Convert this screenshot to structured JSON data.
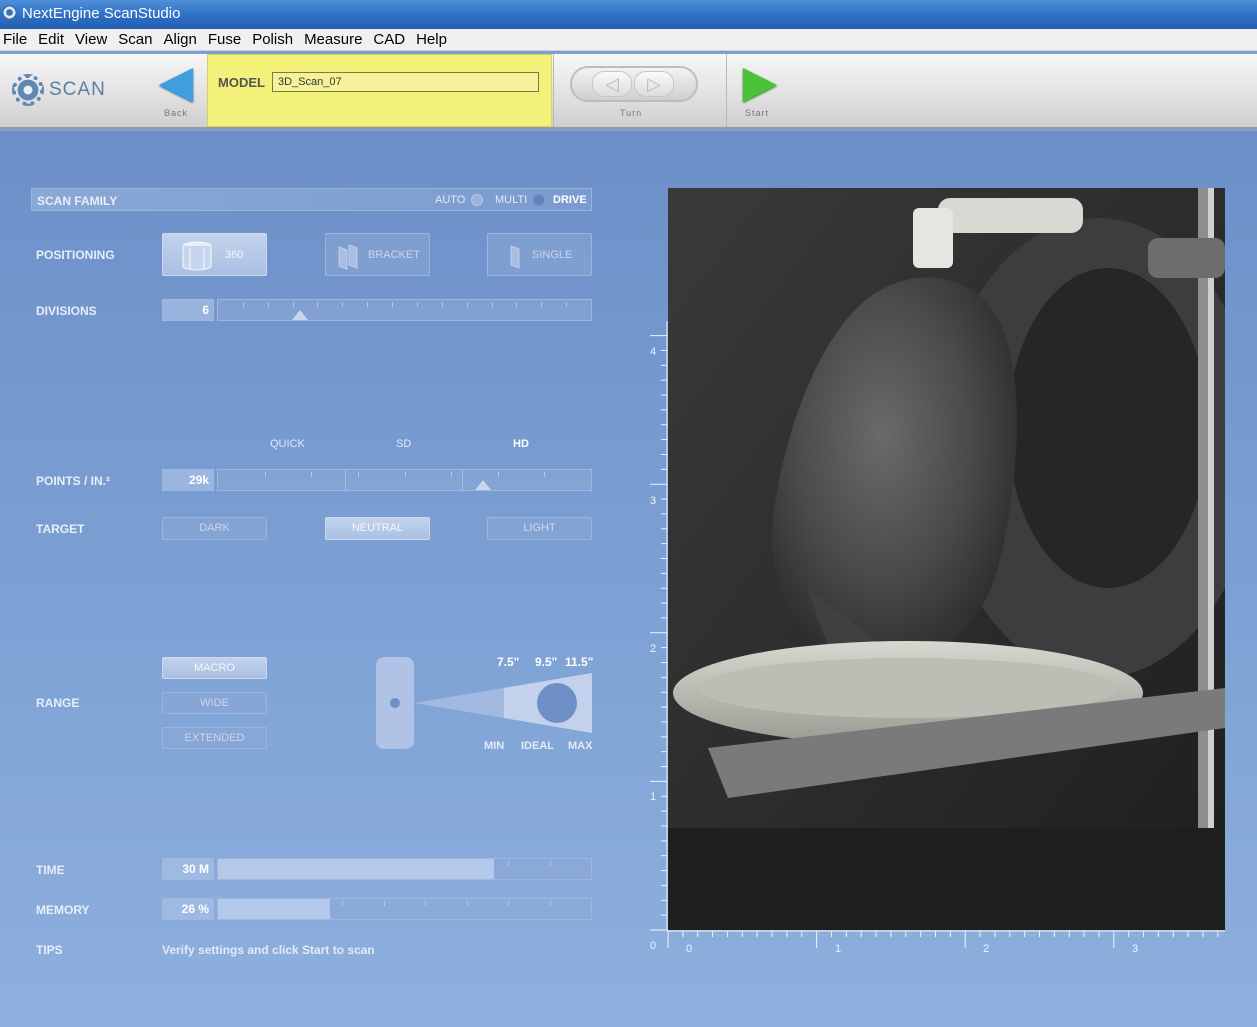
{
  "window": {
    "title": "NextEngine ScanStudio"
  },
  "menu": [
    "File",
    "Edit",
    "View",
    "Scan",
    "Align",
    "Fuse",
    "Polish",
    "Measure",
    "CAD",
    "Help"
  ],
  "toolbar": {
    "section_label": "SCAN",
    "back_label": "Back",
    "model_label": "MODEL",
    "model_value": "3D_Scan_07",
    "turn_label": "Turn",
    "start_label": "Start"
  },
  "scan_family": {
    "label": "SCAN FAMILY",
    "options": [
      {
        "label": "AUTO",
        "selected": false
      },
      {
        "label": "MULTI",
        "selected": true
      },
      {
        "label": "DRIVE",
        "selected": false
      }
    ]
  },
  "positioning": {
    "label": "POSITIONING",
    "options": [
      "360",
      "BRACKET",
      "SINGLE"
    ],
    "selected": "360"
  },
  "divisions": {
    "label": "DIVISIONS",
    "value": "6",
    "level": 0.22
  },
  "points": {
    "label": "POINTS / IN.²",
    "value": "29k",
    "presets": [
      "QUICK",
      "SD",
      "HD"
    ],
    "level": 0.71
  },
  "target": {
    "label": "TARGET",
    "options": [
      "DARK",
      "NEUTRAL",
      "LIGHT"
    ],
    "selected": "NEUTRAL"
  },
  "range": {
    "label": "RANGE",
    "options": [
      "MACRO",
      "WIDE",
      "EXTENDED"
    ],
    "selected": "MACRO",
    "distances": [
      "7.5\"",
      "9.5\"",
      "11.5\""
    ],
    "distance_labels": [
      "MIN",
      "IDEAL",
      "MAX"
    ]
  },
  "time": {
    "label": "TIME",
    "value": "30 M",
    "level": 0.74
  },
  "memory": {
    "label": "MEMORY",
    "value": "26 %",
    "level": 0.3
  },
  "tips": {
    "label": "TIPS",
    "text": "Verify settings and click Start to scan"
  },
  "ruler": {
    "vertical": [
      "4",
      "3",
      "2",
      "1",
      "0"
    ],
    "horizontal": [
      "0",
      "1",
      "2",
      "3"
    ]
  },
  "colors": {
    "accent_highlight": "#f4f17a",
    "start_green": "#4cc23a",
    "back_blue": "#3f9fe0"
  }
}
